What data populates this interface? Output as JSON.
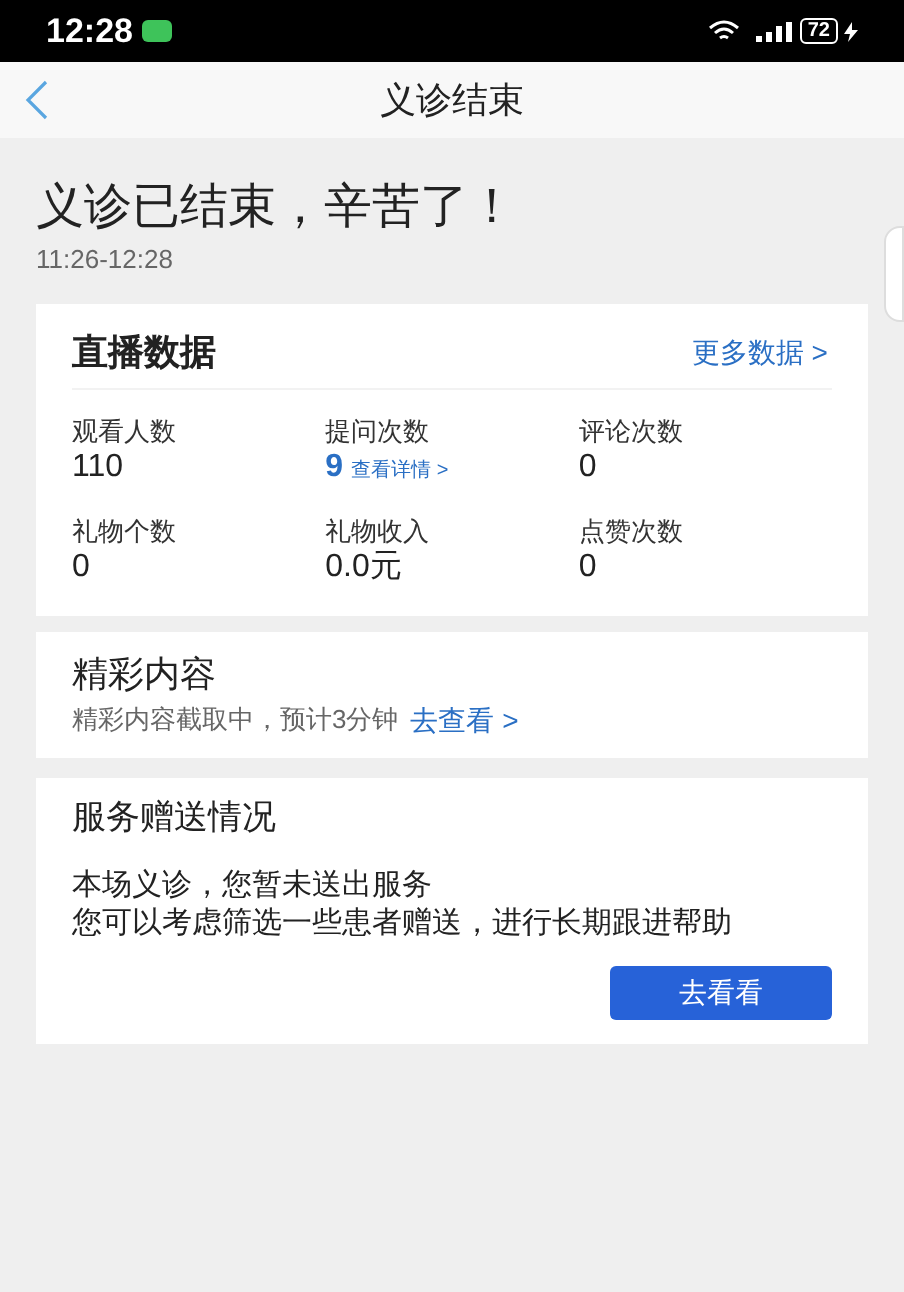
{
  "status_bar": {
    "time": "12:28",
    "battery": "72"
  },
  "nav": {
    "title": "义诊结束"
  },
  "header": {
    "title": "义诊已结束，辛苦了！",
    "time_range": "11:26-12:28"
  },
  "live_data": {
    "title": "直播数据",
    "more_link": "更多数据 >",
    "stats": [
      {
        "label": "观看人数",
        "value": "110"
      },
      {
        "label": "提问次数",
        "value": "9",
        "detail_link": "查看详情 >"
      },
      {
        "label": "评论次数",
        "value": "0"
      },
      {
        "label": "礼物个数",
        "value": "0"
      },
      {
        "label": "礼物收入",
        "value": "0.0元"
      },
      {
        "label": "点赞次数",
        "value": "0"
      }
    ]
  },
  "highlights": {
    "title": "精彩内容",
    "text": "精彩内容截取中，预计3分钟",
    "link": "去查看 >"
  },
  "service": {
    "title": "服务赠送情况",
    "lines": [
      "本场义诊，您暂未送出服务",
      "您可以考虑筛选一些患者赠送，进行长期跟进帮助"
    ],
    "button": "去看看"
  }
}
